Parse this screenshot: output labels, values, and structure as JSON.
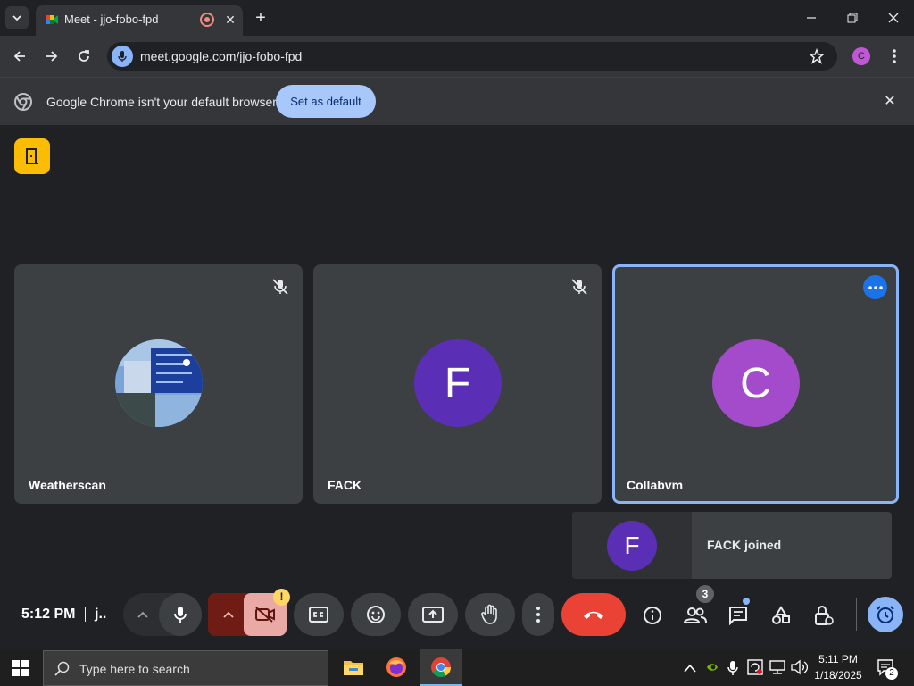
{
  "browser": {
    "tab_title": "Meet - jjo-fobo-fpd",
    "url": "meet.google.com/jjo-fobo-fpd",
    "profile_initial": "C",
    "infobar_text": "Google Chrome isn't your default browser",
    "set_default_label": "Set as default"
  },
  "meet": {
    "participants": [
      {
        "name": "Weatherscan",
        "avatar": "image",
        "muted": true
      },
      {
        "name": "FACK",
        "initial": "F",
        "avatar_color": "#5b2fb5",
        "muted": true
      },
      {
        "name": "Collabvm",
        "initial": "C",
        "avatar_color": "#a44bcb",
        "muted": false,
        "active": true
      }
    ],
    "toast": {
      "initial": "F",
      "text": "FACK joined"
    },
    "time": "5:12 PM",
    "meeting_code": "j..",
    "participant_count": "3",
    "camera_warning": "!"
  },
  "taskbar": {
    "search_placeholder": "Type here to search",
    "clock_time": "5:11 PM",
    "clock_date": "1/18/2025",
    "notification_count": "2"
  },
  "colors": {
    "accent": "#8ab4f8",
    "end_call": "#ea4335",
    "meet_bg": "#202124",
    "tile_bg": "#3c4043"
  }
}
